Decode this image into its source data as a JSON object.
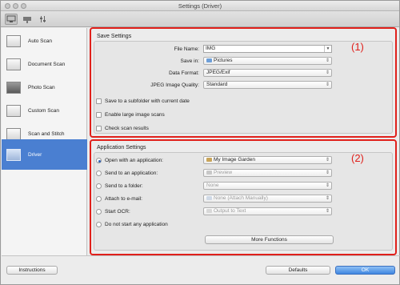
{
  "window": {
    "title": "Settings (Driver)"
  },
  "toolbar": {
    "icons": [
      "scan-from-computer-icon",
      "scan-from-operation-panel-icon",
      "general-settings-icon"
    ]
  },
  "sidebar": {
    "items": [
      {
        "label": "Auto Scan",
        "icon": "auto-scan-icon"
      },
      {
        "label": "Document Scan",
        "icon": "document-scan-icon"
      },
      {
        "label": "Photo Scan",
        "icon": "photo-scan-icon"
      },
      {
        "label": "Custom Scan",
        "icon": "custom-scan-icon"
      },
      {
        "label": "Scan and Stitch",
        "icon": "scan-and-stitch-icon"
      },
      {
        "label": "Driver",
        "icon": "driver-icon"
      }
    ],
    "selected": "Driver"
  },
  "save_settings": {
    "title": "Save Settings",
    "marker": "(1)",
    "file_name_label": "File Name:",
    "file_name_value": "IMG",
    "save_in_label": "Save in:",
    "save_in_value": "Pictures",
    "data_format_label": "Data Format:",
    "data_format_value": "JPEG/Exif",
    "jpeg_quality_label": "JPEG Image Quality:",
    "jpeg_quality_value": "Standard",
    "checkbox_subfolder": "Save to a subfolder with current date",
    "checkbox_large": "Enable large image scans",
    "checkbox_check": "Check scan results"
  },
  "app_settings": {
    "title": "Application Settings",
    "marker": "(2)",
    "open_app_label": "Open with an application:",
    "open_app_value": "My Image Garden",
    "send_app_label": "Send to an application:",
    "send_app_value": "Preview",
    "send_folder_label": "Send to a folder:",
    "send_folder_value": "None",
    "attach_email_label": "Attach to e-mail:",
    "attach_email_value": "None (Attach Manually)",
    "start_ocr_label": "Start OCR:",
    "start_ocr_value": "Output to Text",
    "no_app_label": "Do not start any application",
    "selected_option": "Open with an application:",
    "more_functions": "More Functions"
  },
  "footer": {
    "instructions": "Instructions",
    "defaults": "Defaults",
    "ok": "OK"
  },
  "colors": {
    "highlight": "#e0201b",
    "selection": "#4a7fd1",
    "accent": "#3f86e0"
  }
}
